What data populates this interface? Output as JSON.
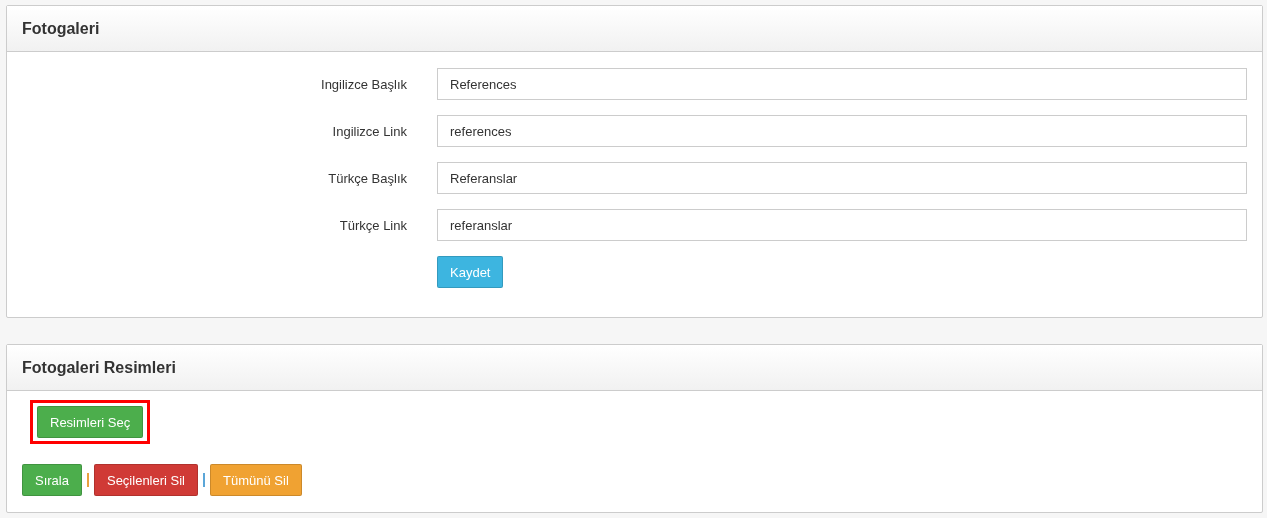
{
  "panels": [
    {
      "title": "Fotogaleri",
      "kind": "form",
      "fields": [
        {
          "label": "Ingilizce Başlık",
          "value": "References"
        },
        {
          "label": "Ingilizce Link",
          "value": "references"
        },
        {
          "label": "Türkçe Başlık",
          "value": "Referanslar"
        },
        {
          "label": "Türkçe Link",
          "value": "referanslar"
        }
      ],
      "submit": {
        "label": "Kaydet",
        "color": "#3db5e0"
      }
    },
    {
      "title": "Fotogaleri Resimleri",
      "kind": "gallery",
      "select_button": {
        "label": "Resimleri Seç",
        "color": "#4cae4c",
        "highlighted": true
      },
      "actions": [
        {
          "kind": "button",
          "label": "Sırala",
          "color": "#4cae4c"
        },
        {
          "kind": "separator",
          "color": "#e8a040"
        },
        {
          "kind": "button",
          "label": "Seçilenleri Sil",
          "color": "#d03a36"
        },
        {
          "kind": "separator",
          "color": "#5ba6d8"
        },
        {
          "kind": "button",
          "label": "Tümünü Sil",
          "color": "#f0a232"
        }
      ]
    }
  ]
}
